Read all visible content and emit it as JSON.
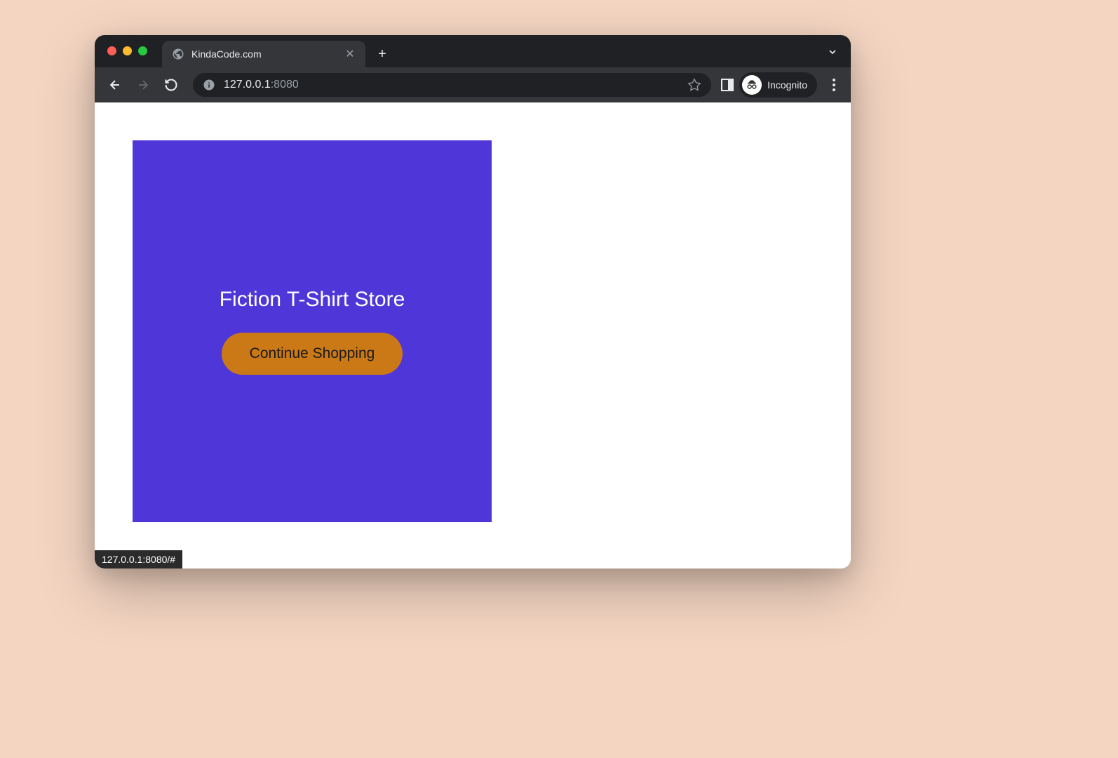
{
  "browser": {
    "tab_title": "KindaCode.com",
    "url_host": "127.0.0.1",
    "url_port": ":8080",
    "incognito_label": "Incognito",
    "status_text": "127.0.0.1:8080/#"
  },
  "page": {
    "card_title": "Fiction T-Shirt Store",
    "cta_label": "Continue Shopping"
  }
}
